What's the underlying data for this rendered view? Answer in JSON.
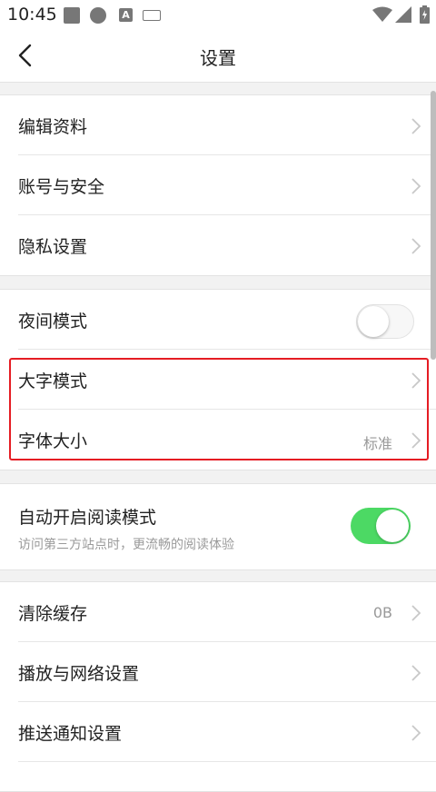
{
  "status_bar": {
    "time": "10:45",
    "keyboard_indicator": "A",
    "icons": [
      "square-notification-icon",
      "circle-notification-icon",
      "a-icon",
      "keyboard-icon",
      "wifi-icon",
      "signal-icon",
      "battery-charging-icon"
    ]
  },
  "header": {
    "title": "设置",
    "back_icon": "chevron-left-icon"
  },
  "sections": [
    {
      "items": [
        {
          "label": "编辑资料",
          "type": "link"
        },
        {
          "label": "账号与安全",
          "type": "link"
        },
        {
          "label": "隐私设置",
          "type": "link"
        }
      ]
    },
    {
      "items": [
        {
          "label": "夜间模式",
          "type": "toggle",
          "checked": false
        },
        {
          "label": "大字模式",
          "type": "link"
        },
        {
          "label": "字体大小",
          "type": "link",
          "value": "标准"
        }
      ]
    },
    {
      "items": [
        {
          "label": "自动开启阅读模式",
          "subtitle": "访问第三方站点时，更流畅的阅读体验",
          "type": "toggle",
          "checked": true
        }
      ]
    },
    {
      "items": [
        {
          "label": "清除缓存",
          "type": "link",
          "value": "0B"
        },
        {
          "label": "播放与网络设置",
          "type": "link"
        },
        {
          "label": "推送通知设置",
          "type": "link"
        }
      ]
    }
  ],
  "colors": {
    "toggle_on": "#4cd964",
    "highlight_border": "#e51c23",
    "page_background": "#f2f2f2"
  }
}
